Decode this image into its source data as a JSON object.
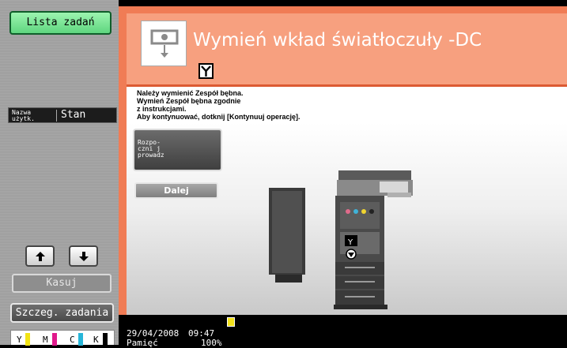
{
  "left_panel": {
    "job_list_label": "Lista zadań",
    "col_user_label": "Nazwa\nużytk.",
    "col_status_label": "Stan",
    "clear_label": "Kasuj",
    "job_details_label": "Szczeg. zadania",
    "toner": [
      {
        "label": "Y",
        "color": "#f2e314"
      },
      {
        "label": "M",
        "color": "#e0198b"
      },
      {
        "label": "C",
        "color": "#27b6d9"
      },
      {
        "label": "K",
        "color": "#000000"
      }
    ]
  },
  "dialog": {
    "title": "Wymień wkład światłoczuły -DC",
    "badge": "Y",
    "message": [
      "Należy wymienić Zespół bębna.",
      "Wymień Zespół bębna zgodnie",
      "z instrukcjami.",
      "Aby kontynuować, dotknij [Kontynuuj operację]."
    ],
    "start_guidance_label": "Rozpo-\nczni j\nprowadz",
    "next_label": "Dalej",
    "machine_badge": "Y"
  },
  "status_bar": {
    "date": "29/04/2008",
    "time": "09:47",
    "memory_label": "Pamięć",
    "memory_value": "100%"
  },
  "colors": {
    "accent": "#f07c55",
    "title_band": "#f7a07f",
    "job_list_green": "#5fd67f"
  }
}
